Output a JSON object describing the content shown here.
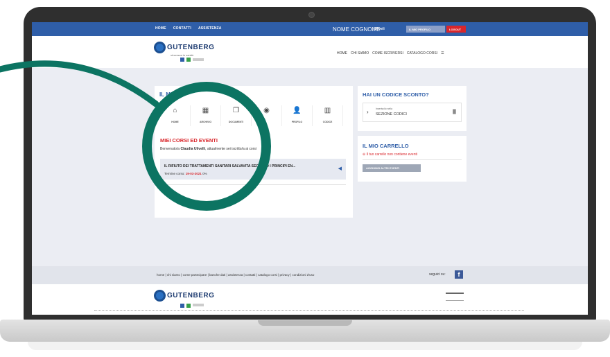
{
  "topbar": {
    "nav": [
      "HOME",
      "CONTATTI",
      "ASSISTENZA"
    ],
    "user_name": "NOME COGNOME",
    "user_short": "Uliveli",
    "profile_btn": "IL MIO PROFILO",
    "logout_btn": "LOGOUT"
  },
  "header": {
    "logo": "GUTENBERG",
    "logo_sub": "sicurezza in sanità",
    "nav": [
      "HOME",
      "CHI SIAMO",
      "COME ISCRIVERSI",
      "CATALOGO CORSI"
    ]
  },
  "main": {
    "title": "IL MIO",
    "tabs": [
      {
        "label": "HOME",
        "icon": "home-icon"
      },
      {
        "label": "ARCHIVIO",
        "icon": "archive-icon"
      },
      {
        "label": "DOCUMENTI",
        "icon": "documents-icon"
      },
      {
        "label": "",
        "icon": "badge-icon"
      },
      {
        "label": "PROFILO",
        "icon": "user-icon"
      },
      {
        "label": "CODICE",
        "icon": "barcode-icon"
      }
    ],
    "section_title": "MIEI CORSI ED EVENTI",
    "welcome_prefix": "Benvenuto/a ",
    "welcome_name": "Claudia Ulivelli",
    "welcome_suffix": ", attualmente sei iscritto/a ai corsi",
    "course": {
      "title": "IL RIFIUTO DEI TRATTAMENTI SANITARI SALVAVITA SECONDO I PRINCIPI EN...",
      "deadline_label": "Termine corso:",
      "deadline": "19-03-2021",
      "progress": "0%"
    }
  },
  "discount": {
    "title": "HAI UN CODICE SCONTO?",
    "small": "Inseriscilo nella",
    "big": "SEZIONE CODICI"
  },
  "cart": {
    "title": "IL MIO CARRELLO",
    "empty": "Il tuo carrello non contiene eventi",
    "button": "AGGIUNGI ALTRI EVENTI"
  },
  "footer": {
    "links": "home | chi siamo | come partecipare | banche dati | assistenza | contatti | catalogo corsi | privacy | condizioni d'uso",
    "follow": "seguici su:",
    "logo": "GUTENBERG"
  },
  "colors": {
    "blue": "#2f5ea8",
    "red": "#d9262b",
    "teal": "#0c7462"
  }
}
